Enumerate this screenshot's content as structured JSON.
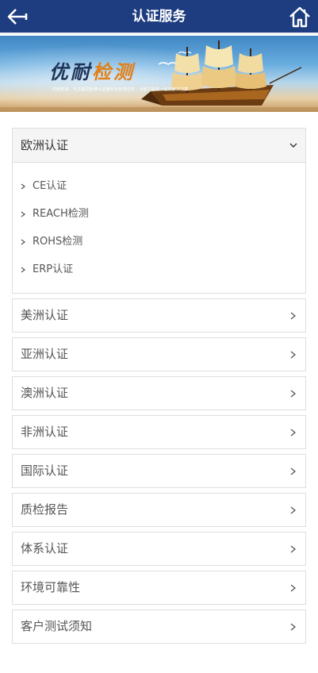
{
  "header": {
    "title": "认证服务",
    "back_icon": "back-arrow-icon",
    "home_icon": "home-icon",
    "bg_color": "#1d3d80"
  },
  "banner": {
    "brand_1": "优耐",
    "brand_2": "检测",
    "tagline": "优耐检测，专注提供各种认证服务及检测业务，为客户提供一站式解决方案"
  },
  "menu": {
    "open_group": {
      "label": "欧洲认证",
      "items": [
        {
          "label": "CE认证"
        },
        {
          "label": "REACH检测"
        },
        {
          "label": "ROHS检测"
        },
        {
          "label": "ERP认证"
        }
      ]
    },
    "groups": [
      {
        "label": "美洲认证"
      },
      {
        "label": "亚洲认证"
      },
      {
        "label": "澳洲认证"
      },
      {
        "label": "非洲认证"
      },
      {
        "label": "国际认证"
      },
      {
        "label": "质检报告"
      },
      {
        "label": "体系认证"
      },
      {
        "label": "环境可靠性"
      },
      {
        "label": "客户测试须知"
      }
    ]
  }
}
